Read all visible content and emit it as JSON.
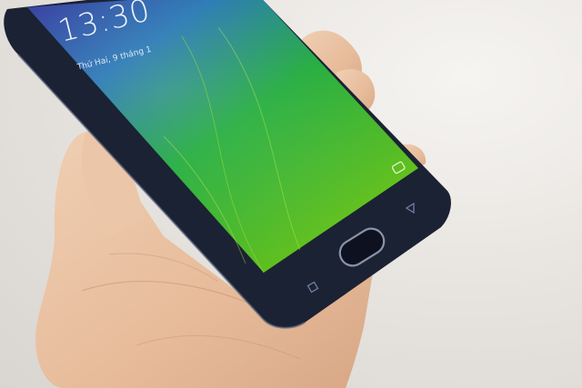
{
  "lockscreen": {
    "time": "13:30",
    "date": "Thứ Hai, 9 tháng 1"
  },
  "colors": {
    "background": "#e9e6e2",
    "phone_body": "#1b2233",
    "screen_top": "#2a3a8a",
    "screen_mid": "#1fae2a",
    "screen_bottom": "#8ecf1c",
    "skin": "#e7c2a4"
  },
  "icons": {
    "camera_shortcut": "camera-icon",
    "nav_back": "back-icon",
    "nav_recent": "recent-apps-icon",
    "home_button": "fingerprint-home-button"
  }
}
